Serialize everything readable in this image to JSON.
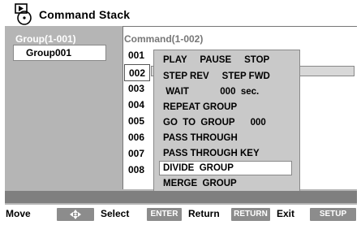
{
  "title": {
    "text": "Command Stack",
    "icon": "disc-player-icon"
  },
  "group_column": {
    "header": "Group(1-001)",
    "items": [
      {
        "label": "Group001"
      }
    ]
  },
  "command_column": {
    "header": "Command(1-002)",
    "rows": [
      {
        "num": "001"
      },
      {
        "num": "002"
      },
      {
        "num": "003"
      },
      {
        "num": "004"
      },
      {
        "num": "005"
      },
      {
        "num": "006"
      },
      {
        "num": "007"
      },
      {
        "num": "008"
      }
    ],
    "selected_row": "002"
  },
  "menu": {
    "items": [
      {
        "label": "PLAY     PAUSE     STOP"
      },
      {
        "label": "STEP REV     STEP FWD"
      },
      {
        "label": " WAIT            000  sec."
      },
      {
        "label": "REPEAT GROUP"
      },
      {
        "label": "GO  TO  GROUP      000"
      },
      {
        "label": "PASS THROUGH"
      },
      {
        "label": "PASS THROUGH KEY"
      },
      {
        "label": "DIVIDE  GROUP"
      },
      {
        "label": "MERGE  GROUP"
      }
    ],
    "highlighted": "DIVIDE  GROUP"
  },
  "help_bar": {
    "move_label": "Move",
    "move_key_icon": "arrow-pad-icon",
    "select_label": "Select",
    "select_key": "ENTER",
    "return_label": "Return",
    "return_key": "RETURN",
    "exit_label": "Exit",
    "exit_key": "SETUP"
  },
  "colors": {
    "panel": "#b5b5b5",
    "key": "#8c8c8c",
    "status": "#7f7f7f"
  }
}
